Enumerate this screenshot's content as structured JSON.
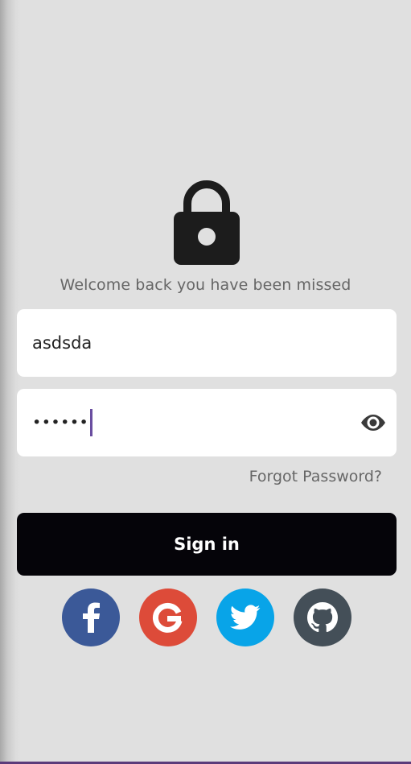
{
  "welcome_text": "Welcome back you have been missed",
  "username": {
    "value": "asdsda"
  },
  "password": {
    "masked_value": "••••••"
  },
  "forgot_password_label": "Forgot Password?",
  "signin_label": "Sign in",
  "social": [
    {
      "name": "facebook",
      "icon": "facebook-icon",
      "color": "#3b5998"
    },
    {
      "name": "google",
      "icon": "google-icon",
      "color": "#dd4b39"
    },
    {
      "name": "twitter",
      "icon": "twitter-icon",
      "color": "#08a4e8"
    },
    {
      "name": "github",
      "icon": "github-icon",
      "color": "#444f58"
    }
  ],
  "colors": {
    "background": "#e0e0e0",
    "button": "#050409",
    "caret": "#6a4ea0",
    "bottom_bar": "#5b3a7a"
  }
}
